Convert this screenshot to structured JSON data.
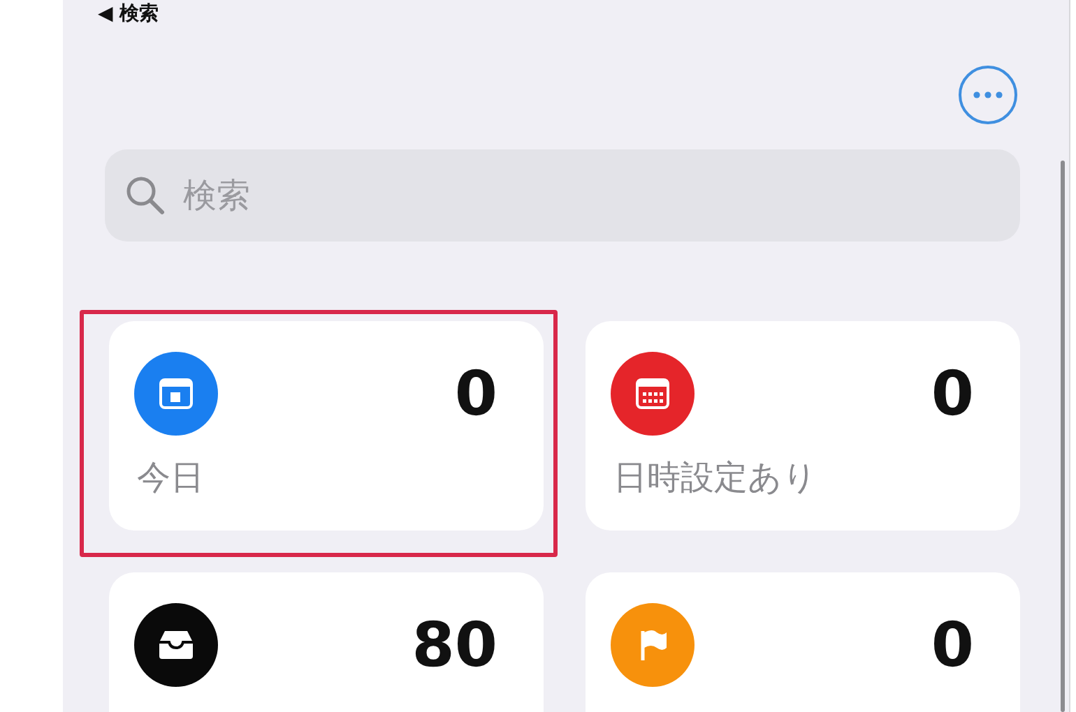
{
  "back_link": {
    "arrow": "◀",
    "label": "検索"
  },
  "search": {
    "placeholder": "検索"
  },
  "smart_lists": [
    {
      "kind": "today",
      "color": "#1a7ff0",
      "count": "0",
      "label": "今日",
      "highlighted": true
    },
    {
      "kind": "scheduled",
      "color": "#e5252a",
      "count": "0",
      "label": "日時設定あり",
      "highlighted": false
    },
    {
      "kind": "all",
      "color": "#0a0a0a",
      "count": "80",
      "highlighted": false
    },
    {
      "kind": "flagged",
      "color": "#f7910c",
      "count": "0",
      "highlighted": false
    }
  ]
}
